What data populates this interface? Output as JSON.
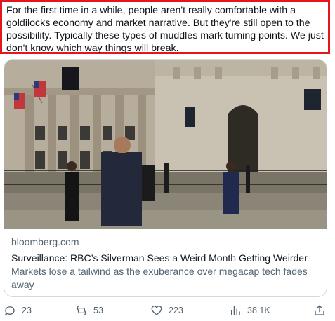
{
  "tweet": {
    "text": "For the first time in a while, people aren't really comfortable with a goldilocks economy and market narrative. But they're still open to the possibility. Typically these types of muddles mark turning points. We just don't know which way things will break."
  },
  "card": {
    "domain": "bloomberg.com",
    "headline": "Surveillance: RBC’s Silverman Sees a Weird Month Getting Weirder",
    "description": "Markets lose a tailwind as the exuberance over megacap tech fades away"
  },
  "actions": {
    "replies": "23",
    "retweets": "53",
    "likes": "223",
    "views": "38.1K"
  },
  "colors": {
    "highlight_border": "#e8141c",
    "muted_text": "#536471",
    "card_border": "#cfd9de"
  },
  "icons": [
    "reply-icon",
    "retweet-icon",
    "like-icon",
    "views-icon",
    "share-icon"
  ]
}
